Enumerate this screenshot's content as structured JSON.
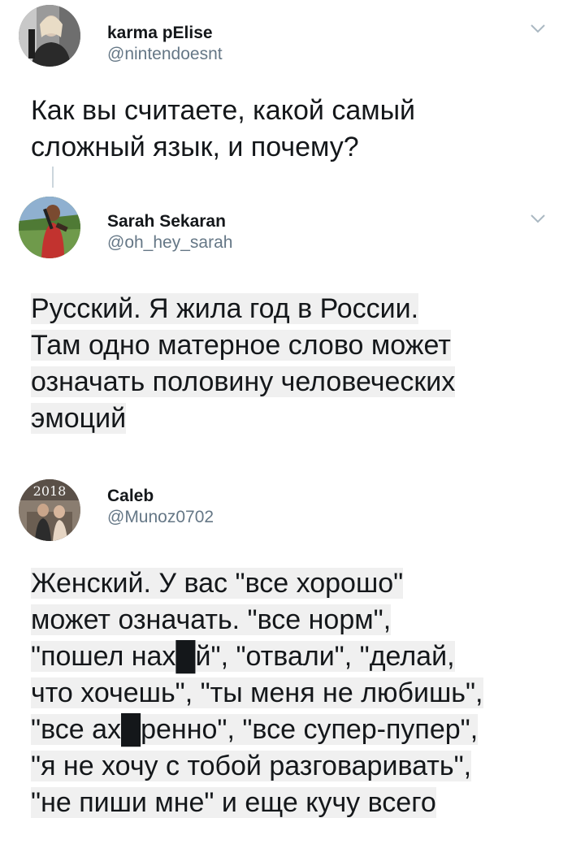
{
  "tweets": [
    {
      "display_name": "karma pElise",
      "handle": "@nintendoesnt",
      "text_lines": [
        "Как вы считаете, какой самый",
        "сложный язык, и почему?"
      ]
    },
    {
      "display_name": "Sarah Sekaran",
      "handle": "@oh_hey_sarah",
      "text_lines": [
        "Русский. Я жила год в России.",
        "Там одно матерное слово может",
        "означать половину человеческих",
        "эмоций"
      ]
    },
    {
      "display_name": "Caleb",
      "handle": "@Munoz0702",
      "avatar_badge": "2018",
      "text_lines": [
        "Женский. У вас \"все хорошо\"",
        "может означать. \"все норм\",",
        "\"пошел нах█й\", \"отвали\", \"делай,",
        "что хочешь\", \"ты меня не любишь\",",
        "\"все ах█ренно\", \"все супер-пупер\",",
        "\"я не хочу с тобой разговаривать\",",
        "\"не пиши мне\" и еще кучу всего"
      ]
    }
  ],
  "icons": {
    "caret": "chevron-down-icon",
    "avatar": "avatar"
  },
  "colors": {
    "name": "#14171a",
    "handle": "#657786",
    "text": "#14171a",
    "caret": "#aab8c2"
  }
}
